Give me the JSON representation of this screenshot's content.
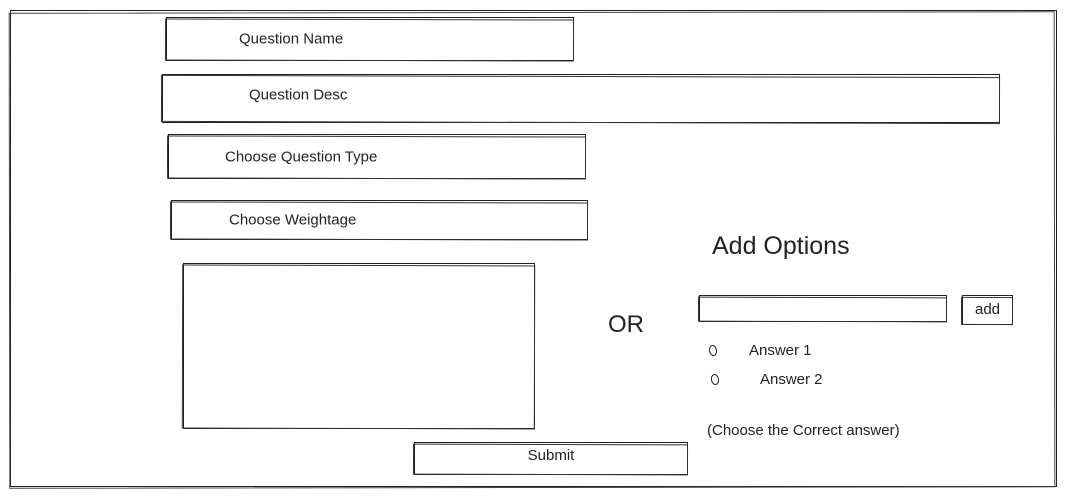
{
  "form": {
    "question_name_label": "Question Name",
    "question_desc_label": "Question Desc",
    "question_type_label": "Choose Question Type",
    "weightage_label": "Choose Weightage",
    "answer_area_value": "",
    "submit_label": "Submit"
  },
  "separator": {
    "or_label": "OR"
  },
  "options": {
    "title": "Add Options",
    "input_value": "",
    "add_label": "add",
    "answers": [
      {
        "label": "Answer 1",
        "icon": "radio-circle-icon"
      },
      {
        "label": "Answer 2",
        "icon": "radio-circle-icon"
      }
    ],
    "hint": "(Choose the Correct answer)"
  }
}
